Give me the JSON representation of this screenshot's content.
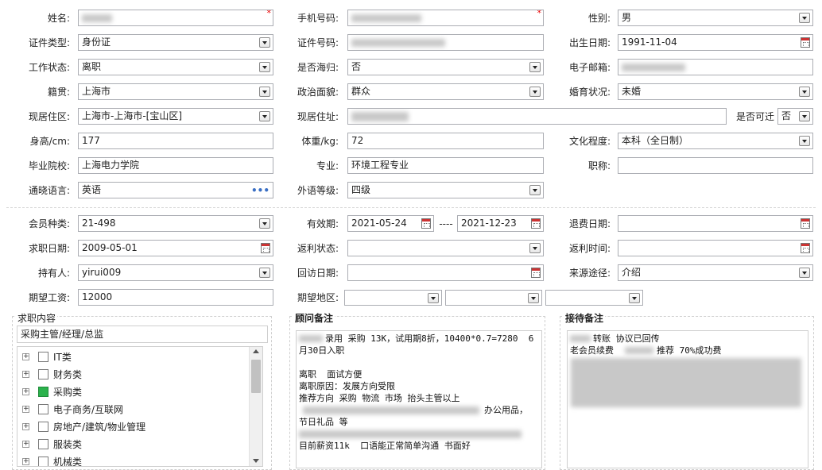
{
  "fields": {
    "name": {
      "label": "姓名:"
    },
    "phone": {
      "label": "手机号码:"
    },
    "gender": {
      "label": "性别:",
      "value": "男"
    },
    "id_type": {
      "label": "证件类型:",
      "value": "身份证"
    },
    "id_no": {
      "label": "证件号码:"
    },
    "birth": {
      "label": "出生日期:",
      "value": "1991-11-04"
    },
    "work_status": {
      "label": "工作状态:",
      "value": "离职"
    },
    "overseas": {
      "label": "是否海归:",
      "value": "否"
    },
    "email": {
      "label": "电子邮箱:"
    },
    "native": {
      "label": "籍贯:",
      "value": "上海市"
    },
    "politics": {
      "label": "政治面貌:",
      "value": "群众"
    },
    "marital": {
      "label": "婚育状况:",
      "value": "未婚"
    },
    "region": {
      "label": "现居住区:",
      "value": "上海市-上海市-[宝山区]"
    },
    "address": {
      "label": "现居住址:"
    },
    "relocate": {
      "label": "是否可迁",
      "value": "否"
    },
    "height": {
      "label": "身高/cm:",
      "value": "177"
    },
    "weight": {
      "label": "体重/kg:",
      "value": "72"
    },
    "education": {
      "label": "文化程度:",
      "value": "本科（全日制）"
    },
    "school": {
      "label": "毕业院校:",
      "value": "上海电力学院"
    },
    "major": {
      "label": "专业:",
      "value": "环境工程专业"
    },
    "title": {
      "label": "职称:",
      "value": ""
    },
    "language": {
      "label": "通晓语言:",
      "value": "英语",
      "more": "•••"
    },
    "lang_level": {
      "label": "外语等级:",
      "value": "四级"
    },
    "member_type": {
      "label": "会员种类:",
      "value": "21-498"
    },
    "valid_from": {
      "label": "有效期:",
      "value": "2021-05-24"
    },
    "valid_sep": "----",
    "valid_to": {
      "value": "2021-12-23"
    },
    "refund_date": {
      "label": "退费日期:",
      "value": ""
    },
    "job_date": {
      "label": "求职日期:",
      "value": "2009-05-01"
    },
    "rebate_status": {
      "label": "返利状态:",
      "value": ""
    },
    "rebate_time": {
      "label": "返利时间:",
      "value": ""
    },
    "holder": {
      "label": "持有人:",
      "value": "yirui009"
    },
    "visit_date": {
      "label": "回访日期:",
      "value": ""
    },
    "source": {
      "label": "来源途径:",
      "value": "介绍"
    },
    "salary": {
      "label": "期望工资:",
      "value": "12000"
    },
    "area": {
      "label": "期望地区:"
    }
  },
  "job_panel": {
    "title": "求职内容",
    "selected": "采购主管/经理/总监",
    "categories": [
      {
        "label": "IT类",
        "checked": false
      },
      {
        "label": "财务类",
        "checked": false
      },
      {
        "label": "采购类",
        "checked": true
      },
      {
        "label": "电子商务/互联网",
        "checked": false
      },
      {
        "label": "房地产/建筑/物业管理",
        "checked": false
      },
      {
        "label": "服装类",
        "checked": false
      },
      {
        "label": "机械类",
        "checked": false
      }
    ]
  },
  "consultant_panel": {
    "title": "顾问备注",
    "lines": [
      "录用 采购 13K，试用期8折，10400*0.7=7280  6",
      "月30日入职",
      "",
      "离职  面试方便",
      "离职原因：发展方向受限",
      "推荐方向 采购 物流 市场 抬头主管以上",
      "办公用品，",
      "节日礼品 等",
      "目前薪资11k  口语能正常简单沟通 书面好"
    ]
  },
  "reception_panel": {
    "title": "接待备注",
    "lines": [
      "转账 协议已回传",
      "老会员续费",
      "推荐 70%成功费"
    ]
  },
  "colors": {
    "required": "#e00000",
    "checked": "#2bb24c",
    "border": "#abadb3"
  }
}
